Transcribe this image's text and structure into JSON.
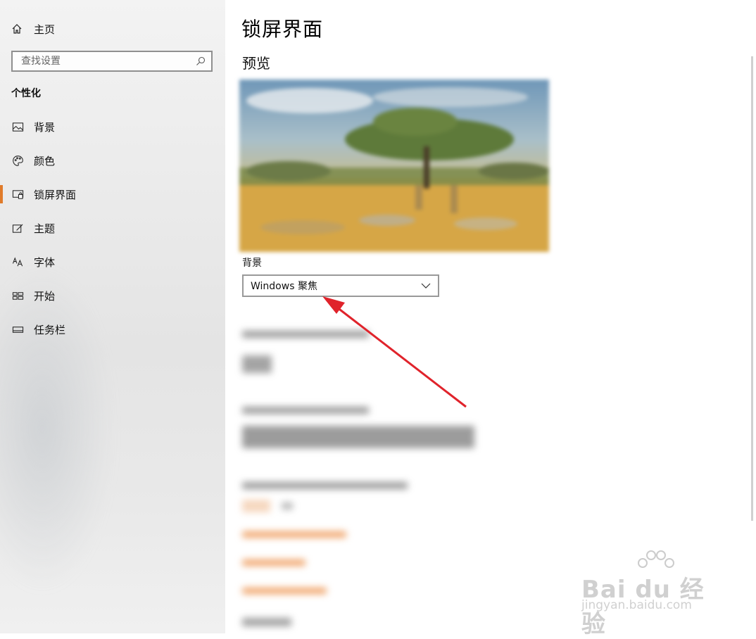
{
  "sidebar": {
    "home_label": "主页",
    "search_placeholder": "查找设置",
    "section_title": "个性化",
    "items": [
      {
        "label": "背景",
        "icon": "picture-icon"
      },
      {
        "label": "颜色",
        "icon": "palette-icon"
      },
      {
        "label": "锁屏界面",
        "icon": "lock-screen-icon",
        "active": true
      },
      {
        "label": "主题",
        "icon": "theme-brush-icon"
      },
      {
        "label": "字体",
        "icon": "font-icon"
      },
      {
        "label": "开始",
        "icon": "start-menu-icon"
      },
      {
        "label": "任务栏",
        "icon": "taskbar-icon"
      }
    ]
  },
  "main": {
    "title": "锁屏界面",
    "preview_heading": "预览",
    "background_label": "背景",
    "background_value": "Windows 聚焦"
  },
  "watermark": {
    "brand": "Bai du 经验",
    "url": "jingyan.baidu.com"
  },
  "colors": {
    "accent": "#e07b2a",
    "annotation_arrow": "#e0232b"
  }
}
